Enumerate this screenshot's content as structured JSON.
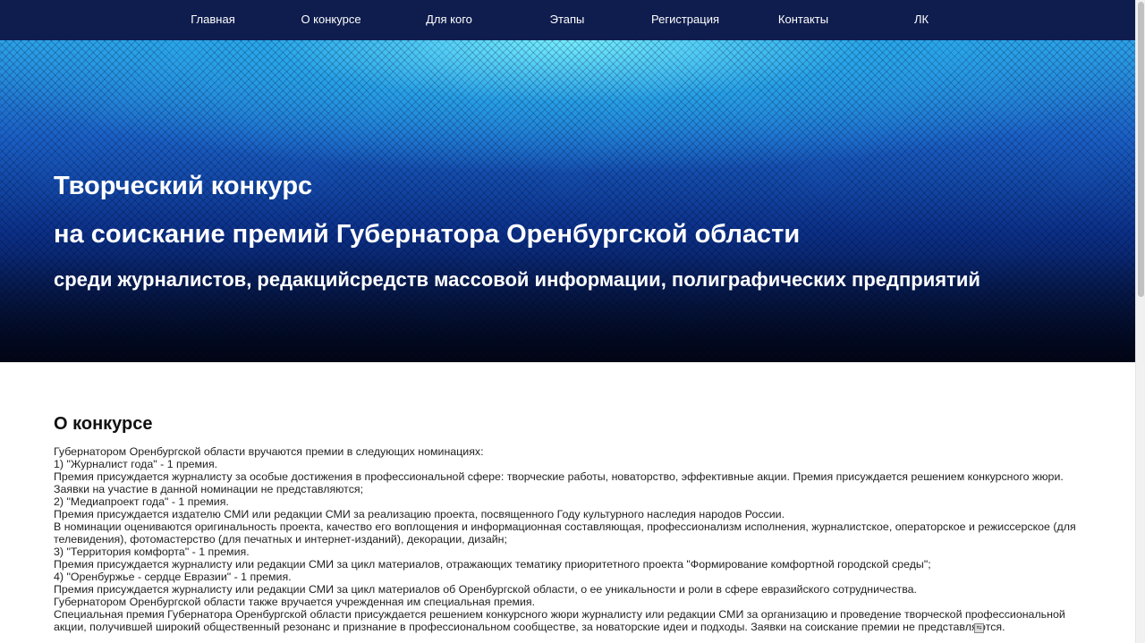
{
  "nav": {
    "items": [
      {
        "label": "Главная"
      },
      {
        "label": "О конкурсе"
      },
      {
        "label": "Для кого"
      },
      {
        "label": "Этапы"
      },
      {
        "label": "Регистрация"
      },
      {
        "label": "Контакты"
      },
      {
        "label": "ЛК"
      }
    ]
  },
  "hero": {
    "line1": "Творческий конкурс",
    "line2": "на соискание премий Губернатора Оренбургской области",
    "line3": "среди журналистов, редакцийсредств массовой информации, полиграфических предприятий"
  },
  "about": {
    "title": "О конкурсе",
    "paragraphs": [
      "Губернатором Оренбургской области вручаются премии в следующих номинациях:",
      "1) \"Журналист года\" - 1 премия.",
      "Премия присуждается журналисту за особые достижения в профессиональной сфере: творческие работы, новаторство, эффективные акции. Премия присуждается решением конкурсного жюри. Заявки на участие в данной номинации не представляются;",
      "2) \"Медиапроект года\" - 1 премия.",
      "Премия присуждается издателю СМИ или редакции СМИ за реализацию проекта, посвященного Году культурного наследия народов России.",
      "В номинации оцениваются оригинальность проекта, качество его воплощения и информационная составляющая, профессионализм исполнения, журналистское, операторское и режиссерское (для телевидения), фотомастерство (для печатных и интернет-изданий), декорации, дизайн;",
      "3) \"Территория комфорта\" - 1 премия.",
      "Премия присуждается журналисту или редакции СМИ за цикл материалов, отражающих тематику приоритетного проекта \"Формирование комфортной городской среды\";",
      "4) \"Оренбуржье - сердце Евразии\" - 1 премия.",
      "Премия присуждается журналисту или редакции СМИ за цикл материалов об Оренбургской области, о ее уникальности и роли в сфере евразийского сотрудничества.",
      "Губернатором Оренбургской области также вручается учрежденная им специальная премия.",
      "Специальная премия Губернатора Оренбургской области присуждается решением конкурсного жюри журналисту или редакции СМИ за организацию и проведение творческой профессиональной акции, получившей широкий общественный резонанс и признание в профессиональном сообществе, за новаторские идеи и подходы. Заявки на соискание премии не представляются."
    ]
  },
  "colors": {
    "nav_bg": "#0f1d4e",
    "hero_top": "#2c9fe6",
    "hero_bottom": "#030b22",
    "text": "#222222"
  },
  "icons": {
    "small_marker": "translate-icon"
  }
}
